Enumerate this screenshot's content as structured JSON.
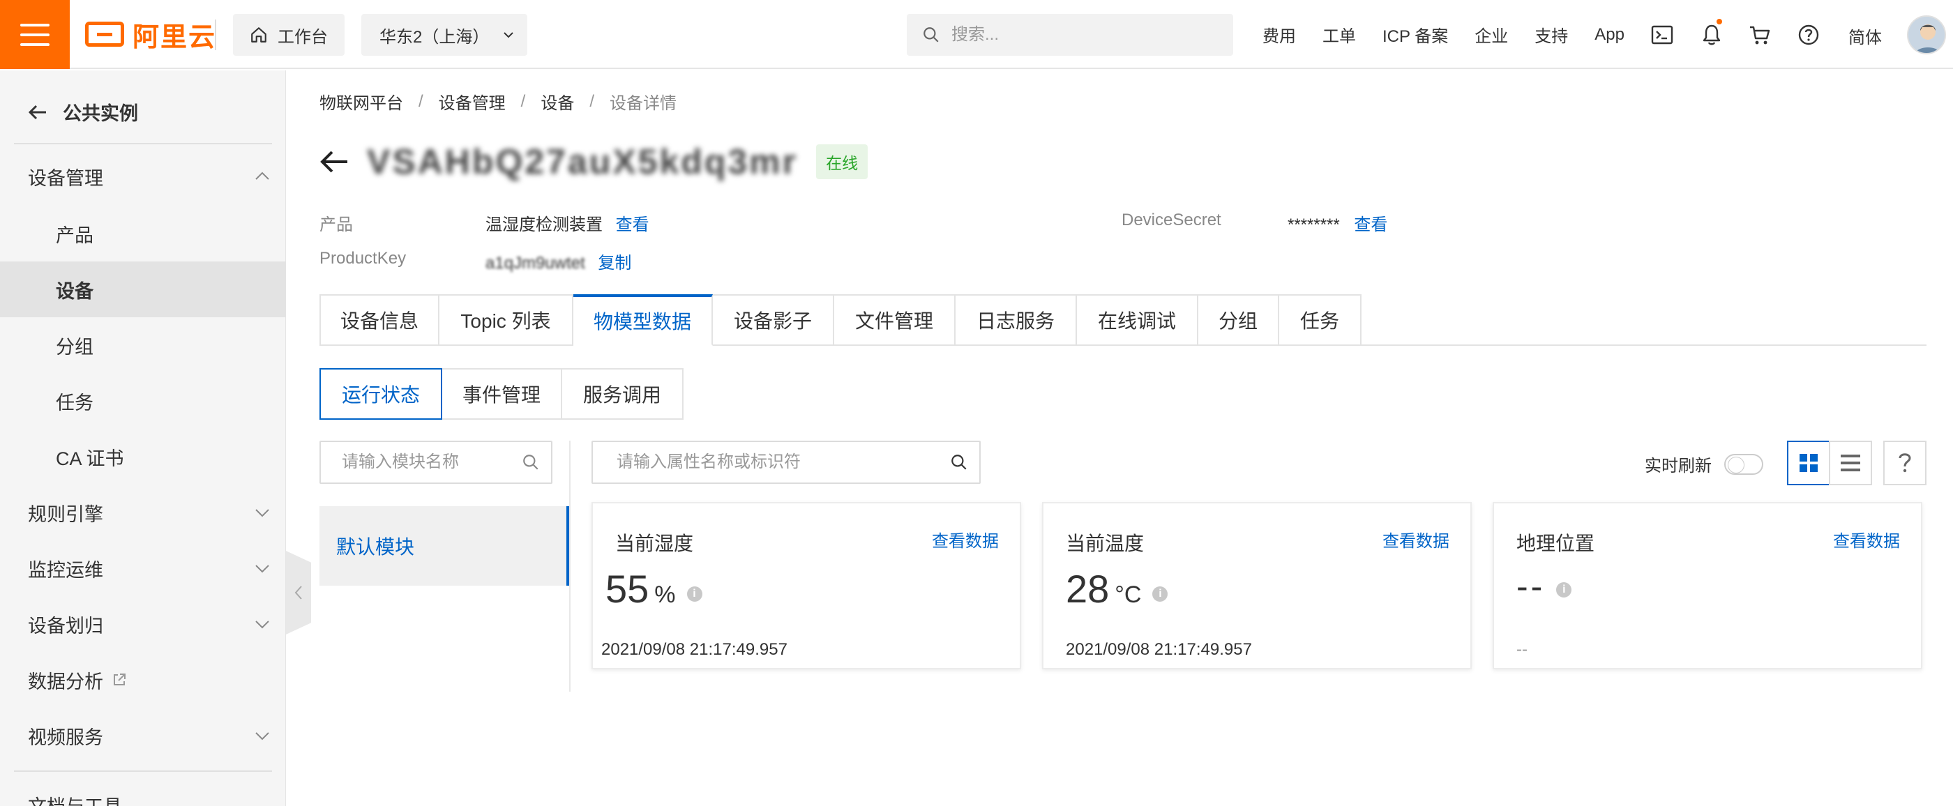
{
  "topbar": {
    "logo_text": "阿里云",
    "workbench_label": "工作台",
    "region_label": "华东2（上海）",
    "search_placeholder": "搜索...",
    "links": [
      "费用",
      "工单",
      "ICP 备案",
      "企业",
      "支持",
      "App"
    ],
    "lang_label": "简体",
    "icons": [
      "terminal-icon",
      "bell-icon",
      "cart-icon",
      "help-icon"
    ]
  },
  "sidebar": {
    "back_label": "公共实例",
    "groups": [
      {
        "label": "设备管理",
        "expanded": true,
        "items": [
          "产品",
          "设备",
          "分组",
          "任务",
          "CA 证书"
        ],
        "active_item": "设备"
      },
      {
        "label": "规则引擎",
        "expanded": false
      },
      {
        "label": "监控运维",
        "expanded": false
      },
      {
        "label": "设备划归",
        "expanded": false
      },
      {
        "label": "数据分析",
        "external": true
      },
      {
        "label": "视频服务",
        "expanded": false
      },
      {
        "label": "文档与工具"
      }
    ]
  },
  "breadcrumb": [
    "物联网平台",
    "设备管理",
    "设备",
    "设备详情"
  ],
  "device": {
    "name": "VSAHbQ27auX5kdq3mr",
    "status": "在线",
    "product_label": "产品",
    "product_value": "温湿度检测装置",
    "product_link": "查看",
    "productkey_label": "ProductKey",
    "productkey_value": "a1qJm9uwtet",
    "productkey_link": "复制",
    "secret_label": "DeviceSecret",
    "secret_value": "********",
    "secret_link": "查看"
  },
  "tabs": [
    "设备信息",
    "Topic 列表",
    "物模型数据",
    "设备影子",
    "文件管理",
    "日志服务",
    "在线调试",
    "分组",
    "任务"
  ],
  "active_tab": "物模型数据",
  "subtabs": [
    "运行状态",
    "事件管理",
    "服务调用"
  ],
  "active_subtab": "运行状态",
  "module_search_placeholder": "请输入模块名称",
  "module_default": "默认模块",
  "property_search_placeholder": "请输入属性名称或标识符",
  "realtime_label": "实时刷新",
  "realtime_on": false,
  "cards": [
    {
      "title": "当前湿度",
      "link": "查看数据",
      "value": "55",
      "unit": "%",
      "time": "2021/09/08 21:17:49.957"
    },
    {
      "title": "当前温度",
      "link": "查看数据",
      "value": "28",
      "unit": "°C",
      "time": "2021/09/08 21:17:49.957"
    },
    {
      "title": "地理位置",
      "link": "查看数据",
      "value": "--",
      "unit": "",
      "time": "--"
    }
  ],
  "colors": {
    "brand": "#ff6a00",
    "accent": "#0064c8",
    "online": "#2aa62a"
  }
}
